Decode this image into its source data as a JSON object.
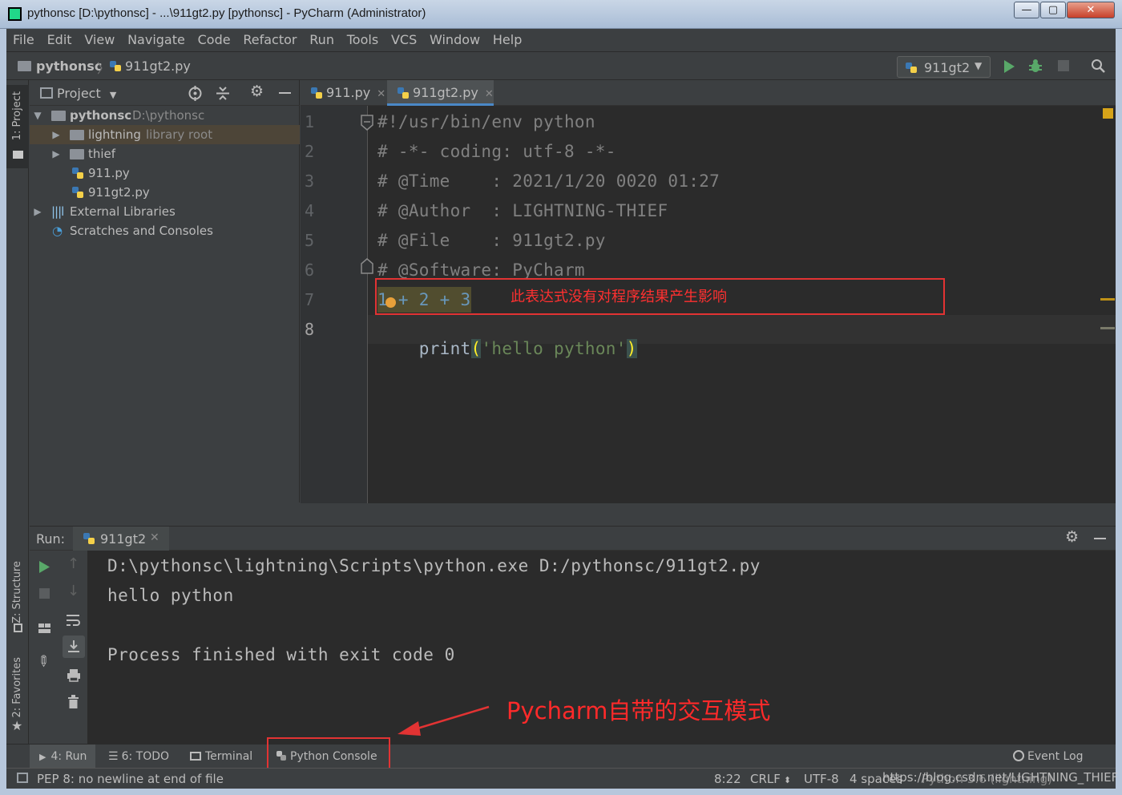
{
  "window": {
    "title": "pythonsc [D:\\pythonsc] - ...\\911gt2.py [pythonsc] - PyCharm (Administrator)",
    "minimize": "—",
    "maximize": "▢",
    "close": "✕"
  },
  "menu": [
    "File",
    "Edit",
    "View",
    "Navigate",
    "Code",
    "Refactor",
    "Run",
    "Tools",
    "VCS",
    "Window",
    "Help"
  ],
  "navbar": {
    "project": "pythonsc",
    "file": "911gt2.py",
    "run_config": "911gt2"
  },
  "left_stripe": {
    "project_tab": "1: Project",
    "structure_tab": "Z: Structure",
    "favorites_tab": "2: Favorites"
  },
  "project_panel": {
    "title": "Project",
    "tree": [
      {
        "name": "pythonsc",
        "extra": "D:\\pythonsc"
      },
      {
        "name": "lightning",
        "extra": "library root"
      },
      {
        "name": "thief",
        "extra": ""
      },
      {
        "name": "911.py",
        "extra": ""
      },
      {
        "name": "911gt2.py",
        "extra": ""
      },
      {
        "name": "External Libraries",
        "extra": ""
      },
      {
        "name": "Scratches and Consoles",
        "extra": ""
      }
    ]
  },
  "editor": {
    "tabs": [
      {
        "label": "911.py"
      },
      {
        "label": "911gt2.py"
      }
    ],
    "line_numbers": [
      "1",
      "2",
      "3",
      "4",
      "5",
      "6",
      "7",
      "8"
    ],
    "lines": [
      "#!/usr/bin/env python",
      "# -*- coding: utf-8 -*-",
      "# @Time    : 2021/1/20 0020 01:27",
      "# @Author  : LIGHTNING-THIEF",
      "# @File    : 911gt2.py",
      "# @Software: PyCharm",
      "1 + 2 + 3",
      "print('hello python')"
    ],
    "line8": {
      "fn": "print",
      "open": "(",
      "str": "'hello python'",
      "close": ")"
    },
    "annotation": "此表达式没有对程序结果产生影响"
  },
  "run_panel": {
    "title": "Run:",
    "tab": "911gt2",
    "output": [
      "D:\\pythonsc\\lightning\\Scripts\\python.exe D:/pythonsc/911gt2.py",
      "hello python",
      "",
      "Process finished with exit code 0"
    ],
    "annotation": "Pycharm自带的交互模式"
  },
  "tool_windows": {
    "run": "4: Run",
    "todo": "6: TODO",
    "terminal": "Terminal",
    "python_console": "Python Console",
    "event_log": "Event Log"
  },
  "status": {
    "message": "PEP 8: no newline at end of file",
    "position": "8:22",
    "line_sep": "CRLF",
    "encoding": "UTF-8",
    "indent": "4 spaces",
    "interpreter": "Python 3.6 (lightning)",
    "watermark": "https://blog.csdn.net/LIGHTNING_THIEF"
  },
  "colors": {
    "accent": "#4a88c7",
    "run_green": "#59a869",
    "annotation_red": "#ff2a2a"
  }
}
